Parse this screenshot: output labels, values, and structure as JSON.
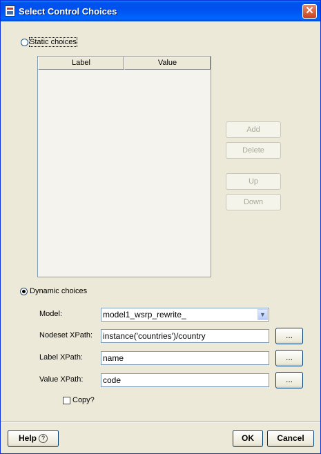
{
  "window": {
    "title": "Select Control Choices",
    "close_glyph": "✕"
  },
  "static": {
    "label": "Static choices",
    "selected": false,
    "table": {
      "columns": [
        "Label",
        "Value"
      ],
      "rows": []
    },
    "buttons": {
      "add": "Add",
      "delete": "Delete",
      "up": "Up",
      "down": "Down"
    }
  },
  "dynamic": {
    "label": "Dynamic choices",
    "selected": true,
    "model": {
      "label": "Model:",
      "value": "model1_wsrp_rewrite_"
    },
    "nodeset": {
      "label": "Nodeset XPath:",
      "value": "instance('countries')/country"
    },
    "label_xpath": {
      "label": "Label XPath:",
      "value": "name"
    },
    "value_xpath": {
      "label": "Value XPath:",
      "value": "code"
    },
    "browse_label": "...",
    "copy": {
      "label": "Copy?",
      "checked": false
    }
  },
  "footer": {
    "help": "Help",
    "help_glyph": "?",
    "ok": "OK",
    "cancel": "Cancel"
  }
}
